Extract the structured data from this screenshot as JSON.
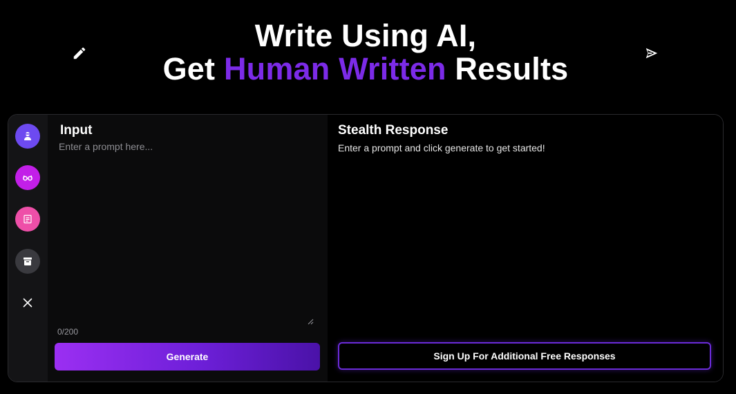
{
  "hero": {
    "line1": "Write Using AI,",
    "line2_prefix": "Get ",
    "line2_accent": "Human Written",
    "line2_suffix": " Results",
    "accent_color": "#7c2be8",
    "left_icon": "pencil-icon",
    "right_icon": "send-icon"
  },
  "sidebar": {
    "items": [
      {
        "icon": "agent-icon",
        "color": "#6d4af0"
      },
      {
        "icon": "glasses-icon",
        "color": "#c21fe8"
      },
      {
        "icon": "document-icon",
        "color": "#ee4fa8"
      },
      {
        "icon": "archive-icon",
        "color": "#3a3a3f"
      },
      {
        "icon": "close-icon",
        "color": "transparent"
      }
    ]
  },
  "input": {
    "title": "Input",
    "placeholder": "Enter a prompt here...",
    "value": "",
    "counter": "0/200",
    "generate_label": "Generate"
  },
  "response": {
    "title": "Stealth Response",
    "text": "Enter a prompt and click generate to get started!",
    "signup_label": "Sign Up For Additional Free Responses",
    "border_color": "#6b2bd9"
  }
}
